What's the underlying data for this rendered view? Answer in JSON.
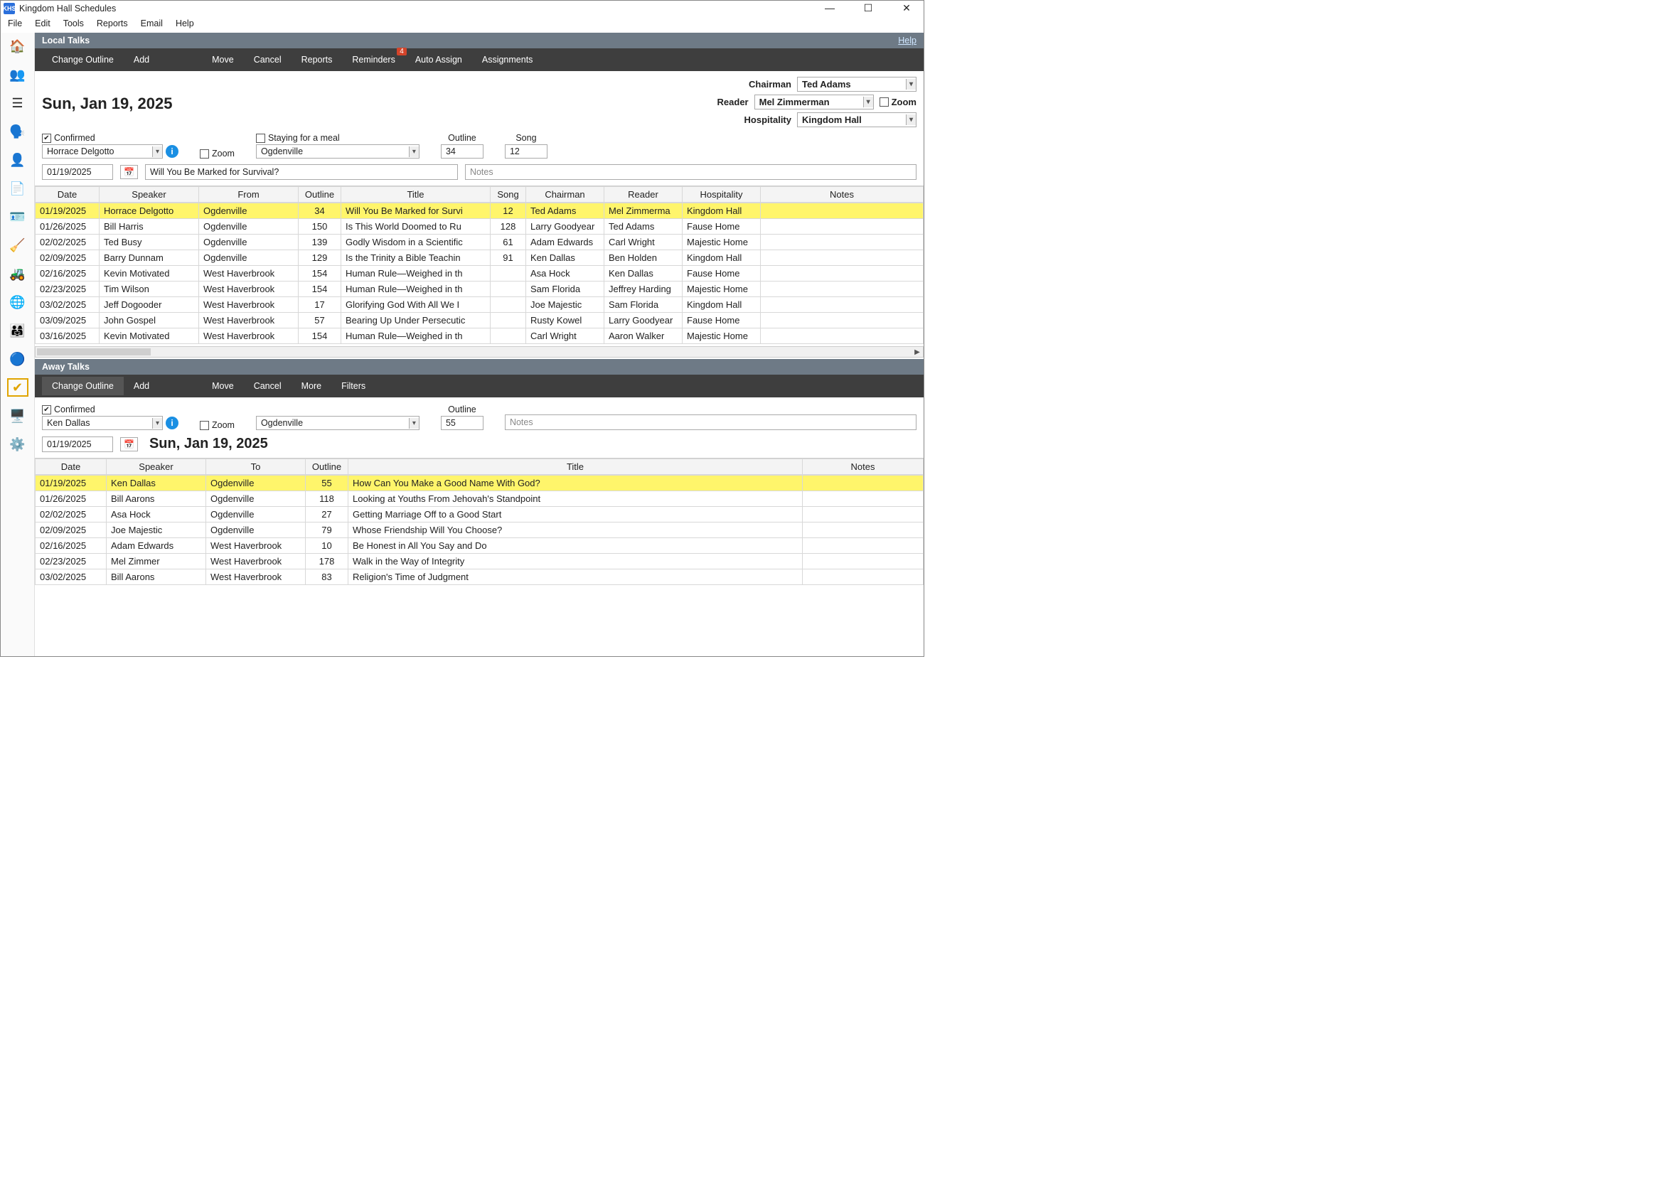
{
  "app_icon_text": "KHS",
  "window_title": "Kingdom Hall Schedules",
  "menu": [
    "File",
    "Edit",
    "Tools",
    "Reports",
    "Email",
    "Help"
  ],
  "local": {
    "header": "Local Talks",
    "help": "Help",
    "toolbar": [
      "Change Outline",
      "Add",
      "Move",
      "Cancel",
      "Reports",
      "Reminders",
      "Auto Assign",
      "Assignments"
    ],
    "reminder_badge": "4",
    "date_heading": "Sun, Jan 19, 2025",
    "labels": {
      "chairman": "Chairman",
      "reader": "Reader",
      "hospitality": "Hospitality",
      "confirmed": "Confirmed",
      "zoom": "Zoom",
      "staying": "Staying for a meal",
      "outline": "Outline",
      "song": "Song",
      "notes_ph": "Notes"
    },
    "chairman": "Ted Adams",
    "reader": "Mel Zimmerman",
    "reader_zoom_label": "Zoom",
    "hospitality": "Kingdom Hall",
    "speaker": "Horrace Delgotto",
    "from": "Ogdenville",
    "outline": "34",
    "song": "12",
    "date_field": "01/19/2025",
    "title_field": "Will You Be Marked for Survival?",
    "columns": [
      "Date",
      "Speaker",
      "From",
      "Outline",
      "Title",
      "Song",
      "Chairman",
      "Reader",
      "Hospitality",
      "Notes"
    ],
    "rows": [
      {
        "d": "01/19/2025",
        "sp": "Horrace Delgotto",
        "fr": "Ogdenville",
        "o": "34",
        "t": "Will You Be Marked for Survi",
        "s": "12",
        "c": "Ted Adams",
        "r": "Mel Zimmerma",
        "h": "Kingdom Hall",
        "n": "",
        "hl": true
      },
      {
        "d": "01/26/2025",
        "sp": "Bill Harris",
        "fr": "Ogdenville",
        "o": "150",
        "t": "Is This World Doomed to Ru",
        "s": "128",
        "c": "Larry Goodyear",
        "r": "Ted Adams",
        "h": "Fause Home",
        "n": ""
      },
      {
        "d": "02/02/2025",
        "sp": "Ted Busy",
        "fr": "Ogdenville",
        "o": "139",
        "t": "Godly Wisdom in a Scientific",
        "s": "61",
        "c": "Adam Edwards",
        "r": "Carl Wright",
        "h": "Majestic Home",
        "n": ""
      },
      {
        "d": "02/09/2025",
        "sp": "Barry Dunnam",
        "fr": "Ogdenville",
        "o": "129",
        "t": "Is the Trinity a Bible Teachin",
        "s": "91",
        "c": "Ken Dallas",
        "r": "Ben Holden",
        "h": "Kingdom Hall",
        "n": ""
      },
      {
        "d": "02/16/2025",
        "sp": "Kevin Motivated",
        "fr": "West Haverbrook",
        "o": "154",
        "t": "Human Rule—Weighed in th",
        "s": "",
        "c": "Asa Hock",
        "r": "Ken Dallas",
        "h": "Fause Home",
        "n": ""
      },
      {
        "d": "02/23/2025",
        "sp": "Tim Wilson",
        "fr": "West Haverbrook",
        "o": "154",
        "t": "Human Rule—Weighed in th",
        "s": "",
        "c": "Sam Florida",
        "r": "Jeffrey Harding",
        "h": "Majestic Home",
        "n": ""
      },
      {
        "d": "03/02/2025",
        "sp": "Jeff Dogooder",
        "fr": "West Haverbrook",
        "o": "17",
        "t": "Glorifying God With All We I",
        "s": "",
        "c": "Joe Majestic",
        "r": "Sam Florida",
        "h": "Kingdom Hall",
        "n": ""
      },
      {
        "d": "03/09/2025",
        "sp": "John Gospel",
        "fr": "West Haverbrook",
        "o": "57",
        "t": "Bearing Up Under Persecutic",
        "s": "",
        "c": "Rusty Kowel",
        "r": "Larry Goodyear",
        "h": "Fause Home",
        "n": ""
      },
      {
        "d": "03/16/2025",
        "sp": "Kevin Motivated",
        "fr": "West Haverbrook",
        "o": "154",
        "t": "Human Rule—Weighed in th",
        "s": "",
        "c": "Carl Wright",
        "r": "Aaron Walker",
        "h": "Majestic Home",
        "n": ""
      }
    ]
  },
  "away": {
    "header": "Away Talks",
    "toolbar": [
      "Change Outline",
      "Add",
      "Move",
      "Cancel",
      "More",
      "Filters"
    ],
    "labels": {
      "confirmed": "Confirmed",
      "zoom": "Zoom",
      "outline": "Outline",
      "notes_ph": "Notes"
    },
    "speaker": "Ken Dallas",
    "to": "Ogdenville",
    "outline": "55",
    "date_field": "01/19/2025",
    "date_heading": "Sun, Jan 19, 2025",
    "columns": [
      "Date",
      "Speaker",
      "To",
      "Outline",
      "Title",
      "Notes"
    ],
    "rows": [
      {
        "d": "01/19/2025",
        "sp": "Ken Dallas",
        "to": "Ogdenville",
        "o": "55",
        "t": "How Can You Make a Good Name With God?",
        "n": "",
        "hl": true
      },
      {
        "d": "01/26/2025",
        "sp": "Bill Aarons",
        "to": "Ogdenville",
        "o": "118",
        "t": "Looking at Youths From Jehovah's Standpoint",
        "n": ""
      },
      {
        "d": "02/02/2025",
        "sp": "Asa Hock",
        "to": "Ogdenville",
        "o": "27",
        "t": "Getting Marriage Off to a Good Start",
        "n": ""
      },
      {
        "d": "02/09/2025",
        "sp": "Joe Majestic",
        "to": "Ogdenville",
        "o": "79",
        "t": "Whose Friendship Will You Choose?",
        "n": ""
      },
      {
        "d": "02/16/2025",
        "sp": "Adam Edwards",
        "to": "West Haverbrook",
        "o": "10",
        "t": "Be Honest in All You Say and Do",
        "n": ""
      },
      {
        "d": "02/23/2025",
        "sp": "Mel Zimmer",
        "to": "West Haverbrook",
        "o": "178",
        "t": "Walk in the Way of Integrity",
        "n": ""
      },
      {
        "d": "03/02/2025",
        "sp": "Bill Aarons",
        "to": "West Haverbrook",
        "o": "83",
        "t": "Religion's Time of Judgment",
        "n": ""
      }
    ]
  }
}
